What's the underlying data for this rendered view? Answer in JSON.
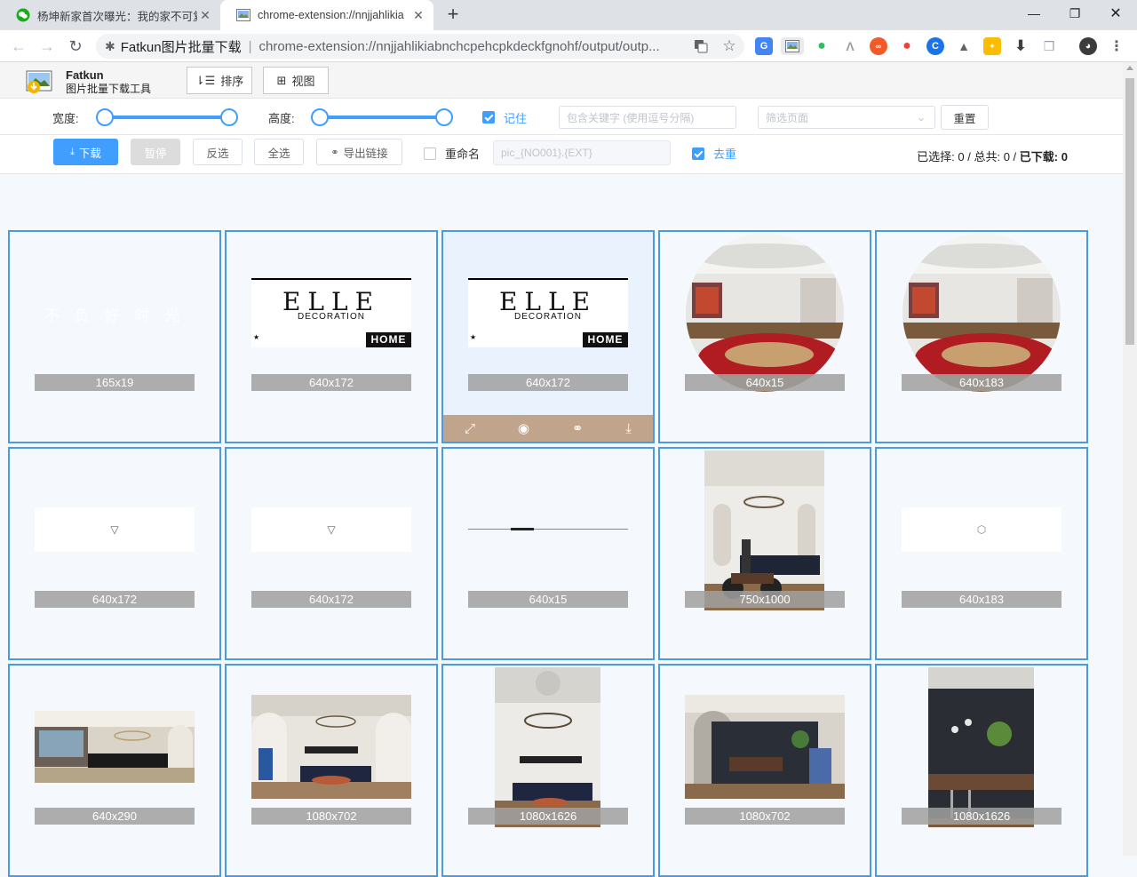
{
  "browser": {
    "tabs": [
      {
        "title": "杨坤新家首次曝光：我的家不可复",
        "icon": "wechat-icon"
      },
      {
        "title": "chrome-extension://nnjjahlikia",
        "icon": "image-icon"
      }
    ],
    "omnibox": {
      "site_name": "Fatkun图片批量下载",
      "url": "chrome-extension://nnjjahlikiabnchcpehcpkdeckfgnohf/output/outp..."
    }
  },
  "app": {
    "name": "Fatkun",
    "subtitle": "图片批量下载工具",
    "sort_label": "排序",
    "view_label": "视图"
  },
  "filters": {
    "width_label": "宽度:",
    "height_label": "高度:",
    "remember_label": "记住",
    "keyword_placeholder": "包含关键字 (使用逗号分隔)",
    "page_filter_placeholder": "筛选页面",
    "reset_label": "重置"
  },
  "actions": {
    "download_label": "下载",
    "pause_label": "暂停",
    "invert_label": "反选",
    "select_all_label": "全选",
    "export_label": "导出链接",
    "rename_label": "重命名",
    "rename_pattern": "pic_{NO001}.{EXT}",
    "dedupe_label": "去重"
  },
  "stats": {
    "selected_label": "已选择:",
    "selected": "0",
    "sep1": "/",
    "total_label": "总共:",
    "total": "0",
    "sep2": "/",
    "downloaded_label": "已下载:",
    "downloaded": "0"
  },
  "images": [
    {
      "size": "165x19",
      "kind": "text-watermark",
      "text": "不 负 好 时 光"
    },
    {
      "size": "640x172",
      "kind": "elle",
      "logo": "ELLE",
      "logo_sub": "DECORATION",
      "badge": "HOME"
    },
    {
      "size": "640x172",
      "kind": "elle",
      "logo": "ELLE",
      "logo_sub": "DECORATION",
      "badge": "HOME"
    },
    {
      "size": "640x15",
      "kind": "circle-room"
    },
    {
      "size": "640x183",
      "kind": "circle-room"
    },
    {
      "size": "640x172",
      "kind": "white-arrow"
    },
    {
      "size": "640x172",
      "kind": "white-arrow"
    },
    {
      "size": "640x15",
      "kind": "line"
    },
    {
      "size": "750x1000",
      "kind": "portrait-room"
    },
    {
      "size": "640x183",
      "kind": "white-dot"
    },
    {
      "size": "640x290",
      "kind": "wide-room"
    },
    {
      "size": "1080x702",
      "kind": "living-room"
    },
    {
      "size": "1080x1626",
      "kind": "tall-room"
    },
    {
      "size": "1080x702",
      "kind": "dark-room"
    },
    {
      "size": "1080x1626",
      "kind": "dark-tall"
    }
  ]
}
